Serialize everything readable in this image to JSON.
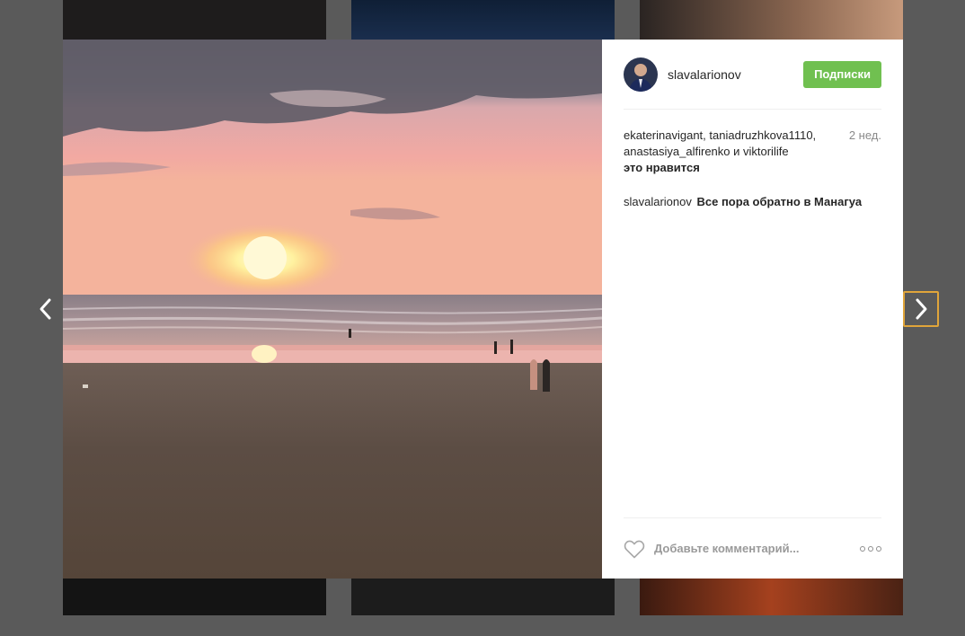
{
  "post": {
    "author": "slavalarionov",
    "follow_label": "Подписки",
    "time_ago": "2 нед.",
    "likes": {
      "users_text": "ekaterinavigant, taniadruzhkova1110, anastasiya_alfirenko и viktorilife",
      "suffix": "это нравится"
    },
    "caption": {
      "user": "slavalarionov",
      "text": "Все пора обратно в Манагуа"
    },
    "comment_placeholder": "Добавьте комментарий..."
  },
  "colors": {
    "follow_button": "#70c050",
    "next_arrow_focus": "#e0a53a"
  },
  "icons": {
    "prev": "chevron-left-icon",
    "next": "chevron-right-icon",
    "like": "heart-icon",
    "more": "more-options-icon"
  }
}
